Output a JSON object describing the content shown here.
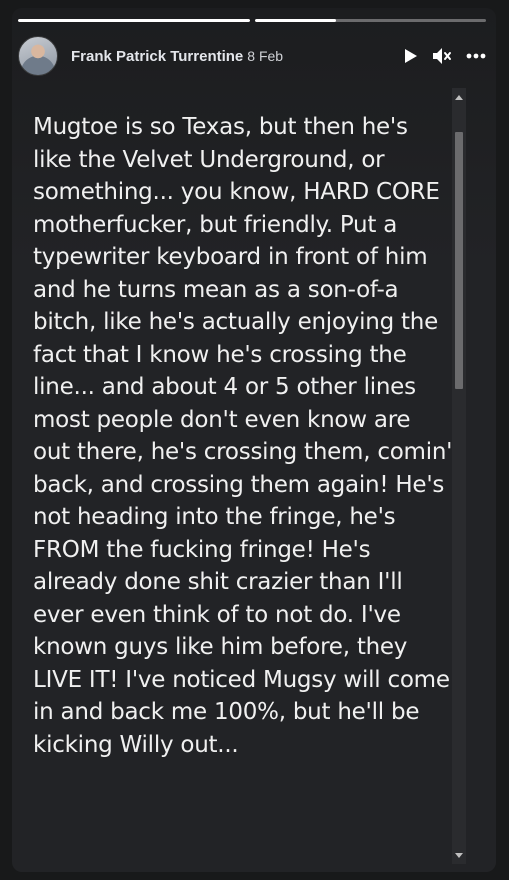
{
  "story": {
    "progress": [
      1.0,
      0.35
    ],
    "author": "Frank Patrick Turrentine",
    "timestamp": "8 Feb",
    "controls": {
      "play_icon": "play-icon",
      "mute_icon": "volume-muted-icon",
      "more_icon": "more-options-icon"
    },
    "text": "Mugtoe is so Texas, but then he's like the Velvet Underground, or something... you know, HARD CORE motherfucker, but friendly. Put a typewriter keyboard in front of him and he turns mean as a son-of-a bitch, like he's actually enjoying the fact that I know he's crossing the line... and about 4 or 5 other lines most people don't even know are out there, he's crossing them, comin' back, and crossing them again! He's not heading into the fringe, he's FROM the fucking fringe! He's already done shit crazier than I'll ever even think of to not do. I've known guys like him before, they LIVE IT! I've noticed Mugsy will come in and back me 100%, but he'll be kicking Willy out..."
  },
  "colors": {
    "background": "#18191a",
    "card": "#222326",
    "text": "#f0f0f0",
    "scrollbar_thumb": "#6b6b6d"
  }
}
